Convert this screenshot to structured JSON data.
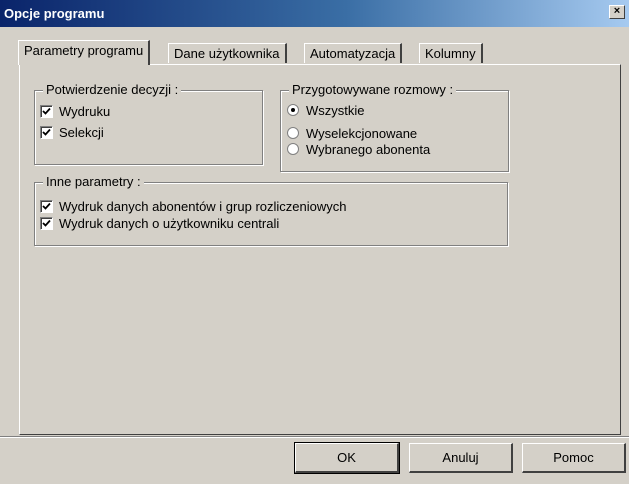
{
  "window": {
    "title": "Opcje programu",
    "close_label": "×"
  },
  "tabs": [
    {
      "label": "Parametry programu",
      "active": true
    },
    {
      "label": "Dane użytkownika",
      "active": false
    },
    {
      "label": "Automatyzacja",
      "active": false
    },
    {
      "label": "Kolumny",
      "active": false
    }
  ],
  "group_confirm": {
    "title": "Potwierdzenie decyzji :",
    "options": [
      {
        "label": "Wydruku",
        "checked": true
      },
      {
        "label": "Selekcji",
        "checked": true
      }
    ]
  },
  "group_calls": {
    "title": "Przygotowywane rozmowy :",
    "options": [
      {
        "label": "Wszystkie",
        "selected": true
      },
      {
        "label": "Wyselekcjonowane",
        "selected": false
      },
      {
        "label": "Wybranego abonenta",
        "selected": false
      }
    ]
  },
  "group_other": {
    "title": "Inne parametry :",
    "options": [
      {
        "label": "Wydruk danych abonentów i grup rozliczeniowych",
        "checked": true
      },
      {
        "label": "Wydruk danych o użytkowniku centrali",
        "checked": true
      }
    ]
  },
  "buttons": {
    "ok": "OK",
    "cancel": "Anuluj",
    "help": "Pomoc"
  }
}
